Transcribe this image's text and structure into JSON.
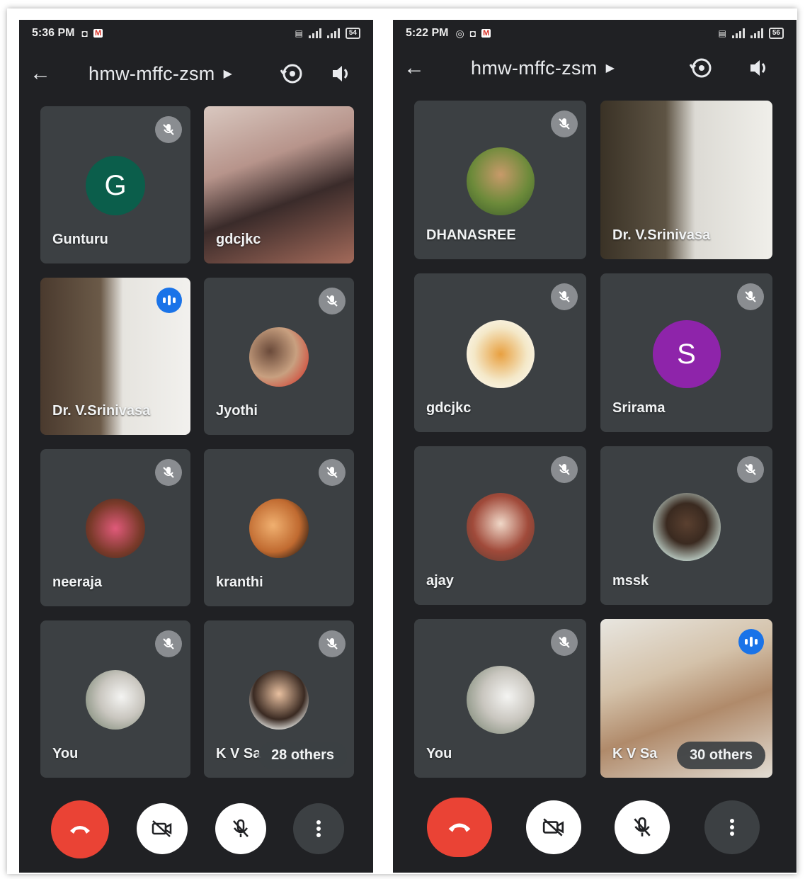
{
  "left": {
    "status": {
      "time": "5:36 PM",
      "battery": "54"
    },
    "meeting_code": "hmw-mffc-zsm",
    "tiles": [
      {
        "name": "Gunturu",
        "avatar_letter": "G",
        "avatar_color": "#0b5e4b"
      },
      {
        "name": "gdcjkc"
      },
      {
        "name": "Dr. V.Srinivasa"
      },
      {
        "name": "Jyothi"
      },
      {
        "name": "neeraja"
      },
      {
        "name": "kranthi"
      },
      {
        "name": "You"
      },
      {
        "name": "K V Sa",
        "others": "28 others"
      }
    ]
  },
  "right": {
    "status": {
      "time": "5:22 PM",
      "battery": "56"
    },
    "meeting_code": "hmw-mffc-zsm",
    "tiles": [
      {
        "name": "DHANASREE"
      },
      {
        "name": "Dr. V.Srinivasa"
      },
      {
        "name": "gdcjkc"
      },
      {
        "name": "Srirama",
        "avatar_letter": "S",
        "avatar_color": "#8e24aa"
      },
      {
        "name": "ajay"
      },
      {
        "name": "mssk"
      },
      {
        "name": "You"
      },
      {
        "name": "K V Sa",
        "others": "30 others"
      }
    ]
  },
  "icons": {
    "back": "arrow-left-icon",
    "switch_camera": "switch-camera-icon",
    "speaker": "speaker-icon",
    "muted": "mic-off-icon",
    "speaking": "speaking-indicator-icon",
    "end_call": "end-call-icon",
    "camera_off": "camera-off-icon",
    "mic_off": "mic-off-icon",
    "more": "more-vert-icon"
  },
  "colors": {
    "end_call": "#ea4335",
    "speaking": "#1a73e8",
    "background": "#202124",
    "tile": "#3c4043"
  }
}
